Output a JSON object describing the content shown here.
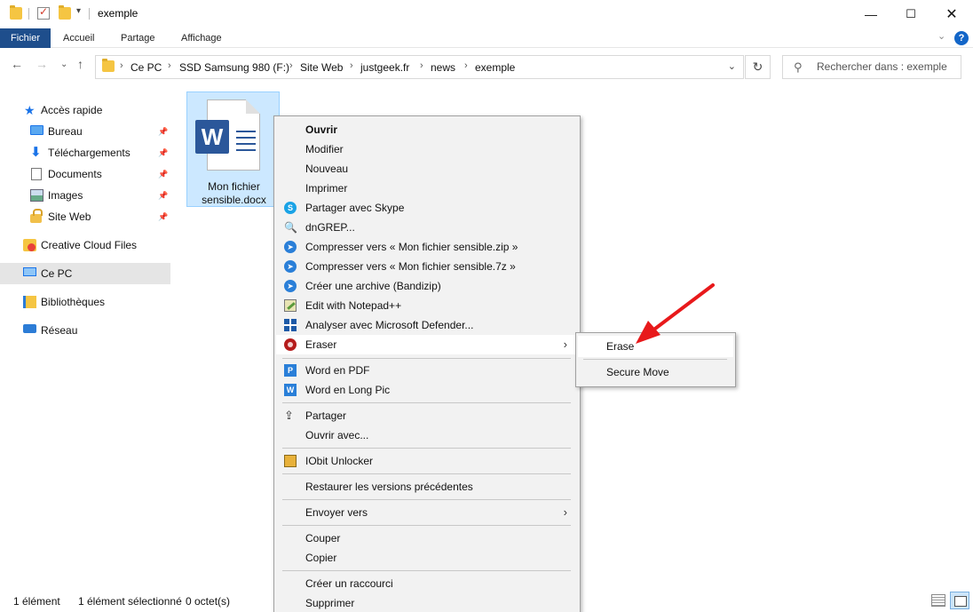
{
  "window": {
    "title": "exemple"
  },
  "ribbon": {
    "tabs": [
      "Fichier",
      "Accueil",
      "Partage",
      "Affichage"
    ]
  },
  "address": {
    "crumbs": [
      "Ce PC",
      "SSD Samsung 980 (F:)",
      "Site Web",
      "justgeek.fr",
      "news",
      "exemple"
    ]
  },
  "search": {
    "placeholder": "Rechercher dans : exemple"
  },
  "sidebar": {
    "items": [
      {
        "label": "Accès rapide",
        "icon": "star-icon"
      },
      {
        "label": "Bureau",
        "icon": "desktop-icon",
        "pinned": true
      },
      {
        "label": "Téléchargements",
        "icon": "download-icon",
        "pinned": true
      },
      {
        "label": "Documents",
        "icon": "document-icon",
        "pinned": true
      },
      {
        "label": "Images",
        "icon": "pictures-icon",
        "pinned": true
      },
      {
        "label": "Site Web",
        "icon": "lock-folder-icon",
        "pinned": true
      },
      {
        "label": "Creative Cloud Files",
        "icon": "creative-cloud-icon"
      },
      {
        "label": "Ce PC",
        "icon": "pc-icon",
        "selected": true
      },
      {
        "label": "Bibliothèques",
        "icon": "library-icon"
      },
      {
        "label": "Réseau",
        "icon": "network-icon"
      }
    ]
  },
  "file": {
    "name": "Mon fichier sensible.docx",
    "badge": "W"
  },
  "context_menu": {
    "items": [
      {
        "label": "Ouvrir",
        "bold": true
      },
      {
        "label": "Modifier"
      },
      {
        "label": "Nouveau"
      },
      {
        "label": "Imprimer"
      },
      {
        "label": "Partager avec Skype",
        "icon": "skype-icon"
      },
      {
        "label": "dnGREP...",
        "icon": "magnifier-icon"
      },
      {
        "label": "Compresser vers « Mon fichier sensible.zip »",
        "icon": "bandizip-icon"
      },
      {
        "label": "Compresser vers « Mon fichier sensible.7z »",
        "icon": "bandizip-icon"
      },
      {
        "label": "Créer une archive (Bandizip)",
        "icon": "bandizip-icon"
      },
      {
        "label": "Edit with Notepad++",
        "icon": "notepadpp-icon"
      },
      {
        "label": "Analyser avec Microsoft Defender...",
        "icon": "defender-icon"
      },
      {
        "label": "Eraser",
        "icon": "eraser-icon",
        "submenu": true
      },
      {
        "label": "Word en PDF",
        "icon": "word-pdf-icon"
      },
      {
        "label": "Word en Long Pic",
        "icon": "word-longpic-icon"
      },
      {
        "label": "Partager",
        "icon": "share-icon"
      },
      {
        "label": "Ouvrir avec..."
      },
      {
        "label": "IObit Unlocker",
        "icon": "iobit-icon"
      },
      {
        "label": "Restaurer les versions précédentes"
      },
      {
        "label": "Envoyer vers",
        "submenu": true
      },
      {
        "label": "Couper"
      },
      {
        "label": "Copier"
      },
      {
        "label": "Créer un raccourci"
      },
      {
        "label": "Supprimer"
      }
    ]
  },
  "submenu": {
    "items": [
      "Erase",
      "Secure Move"
    ]
  },
  "status": {
    "count": "1 élément",
    "selection": "1 élément sélectionné",
    "size": "0 octet(s)"
  },
  "colors": {
    "file_tab": "#1e4e8c",
    "selection_fill": "#cce8ff",
    "annotation_arrow": "#e8191b"
  }
}
